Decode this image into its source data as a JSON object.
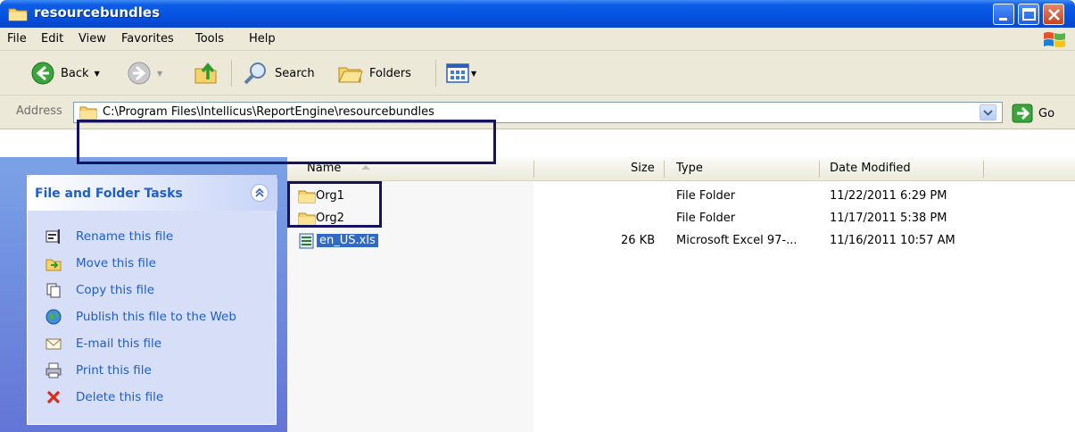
{
  "window": {
    "title": "resourcebundles"
  },
  "menu": {
    "items": [
      "File",
      "Edit",
      "View",
      "Favorites",
      "Tools",
      "Help"
    ]
  },
  "toolbar": {
    "back_label": "Back",
    "search_label": "Search",
    "folders_label": "Folders"
  },
  "address": {
    "label": "Address",
    "path": "C:\\Program Files\\Intellicus\\ReportEngine\\resourcebundles",
    "go_label": "Go"
  },
  "tasks": {
    "title": "File and Folder Tasks",
    "items": [
      {
        "label": "Rename this file",
        "icon": "rename-icon"
      },
      {
        "label": "Move this file",
        "icon": "move-icon"
      },
      {
        "label": "Copy this file",
        "icon": "copy-icon"
      },
      {
        "label": "Publish this file to the Web",
        "icon": "globe-icon"
      },
      {
        "label": "E-mail this file",
        "icon": "email-icon"
      },
      {
        "label": "Print this file",
        "icon": "printer-icon"
      },
      {
        "label": "Delete this file",
        "icon": "delete-icon"
      }
    ]
  },
  "filelist": {
    "columns": {
      "name": "Name",
      "size": "Size",
      "type": "Type",
      "date": "Date Modified"
    },
    "rows": [
      {
        "name": "Org1",
        "size": "",
        "type": "File Folder",
        "date": "11/22/2011 6:29 PM",
        "icon": "folder-icon"
      },
      {
        "name": "Org2",
        "size": "",
        "type": "File Folder",
        "date": "11/17/2011 5:38 PM",
        "icon": "folder-icon"
      },
      {
        "name": "en_US.xls",
        "size": "26 KB",
        "type": "Microsoft Excel 97-...",
        "date": "11/16/2011 10:57 AM",
        "icon": "excel-file-icon",
        "selected": true
      }
    ]
  },
  "colors": {
    "title_blue": "#0451e0",
    "link_blue": "#215dc6",
    "selection": "#316ac5",
    "highlight_box": "#14145e"
  }
}
